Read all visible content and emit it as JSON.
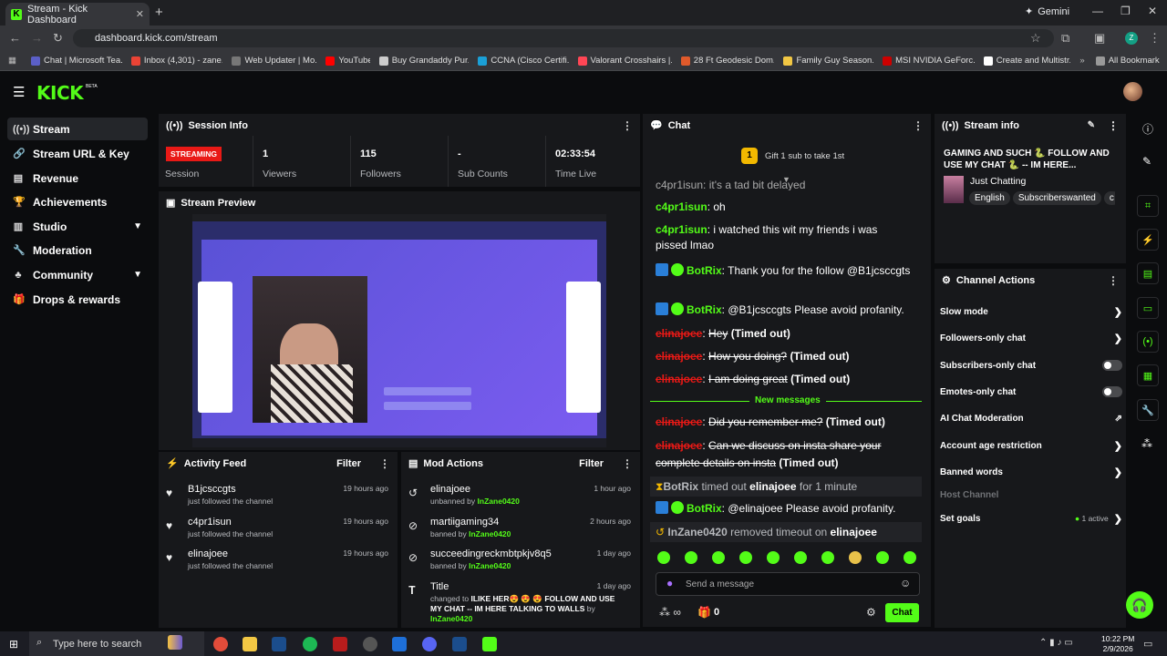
{
  "browser": {
    "tab_title": "Stream - Kick Dashboard",
    "url": "dashboard.kick.com/stream",
    "gemini": "Gemini",
    "bookmarks": [
      "Chat | Microsoft Tea...",
      "Inbox (4,301) - zane...",
      "Web Updater | Mo...",
      "YouTube",
      "Buy Grandaddy Pur...",
      "CCNA (Cisco Certifi...",
      "Valorant Crosshairs |...",
      "28 Ft Geodesic Dom...",
      "Family Guy Season...",
      "MSI NVIDIA GeForc...",
      "Create and Multistr..."
    ],
    "all_bookmarks": "All Bookmarks"
  },
  "brand": {
    "logo": "KICK",
    "beta": "BETA"
  },
  "sidebar": {
    "items": [
      {
        "label": "Stream",
        "icon": "broadcast-icon"
      },
      {
        "label": "Stream URL & Key",
        "icon": "link-icon"
      },
      {
        "label": "Revenue",
        "icon": "revenue-icon"
      },
      {
        "label": "Achievements",
        "icon": "trophy-icon"
      },
      {
        "label": "Studio",
        "icon": "studio-icon"
      },
      {
        "label": "Moderation",
        "icon": "wrench-icon"
      },
      {
        "label": "Community",
        "icon": "community-icon"
      },
      {
        "label": "Drops & rewards",
        "icon": "gift-icon"
      }
    ]
  },
  "session": {
    "title": "Session Info",
    "status": "STREAMING",
    "status_label": "Session",
    "stats": [
      {
        "value": "1",
        "label": "Viewers"
      },
      {
        "value": "115",
        "label": "Followers"
      },
      {
        "value": "-",
        "label": "Sub Counts"
      },
      {
        "value": "02:33:54",
        "label": "Time Live"
      }
    ]
  },
  "preview": {
    "title": "Stream Preview"
  },
  "activity": {
    "title": "Activity Feed",
    "filter": "Filter",
    "items": [
      {
        "name": "B1jcsccgts",
        "sub": "just followed the channel",
        "time": "19 hours ago"
      },
      {
        "name": "c4pr1isun",
        "sub": "just followed the channel",
        "time": "19 hours ago"
      },
      {
        "name": "elinajoee",
        "sub": "just followed the channel",
        "time": "19 hours ago"
      }
    ]
  },
  "mod": {
    "title": "Mod Actions",
    "filter": "Filter",
    "items": [
      {
        "name": "elinajoee",
        "action": "unbanned by",
        "by": "InZane0420",
        "time": "1 hour ago"
      },
      {
        "name": "martiigaming34",
        "action": "banned by",
        "by": "InZane0420",
        "time": "2 hours ago"
      },
      {
        "name": "succeedingreckmbtpkjv8q5",
        "action": "banned by",
        "by": "InZane0420",
        "time": "1 day ago"
      },
      {
        "name": "Title",
        "action": "changed to",
        "detail": "ILIKE HER😍 😍 😍 FOLLOW AND USE MY CHAT -- IM HERE TALKING TO WALLS",
        "by_prefix": "by",
        "by": "InZane0420",
        "time": "1 day ago"
      }
    ]
  },
  "chat": {
    "title": "Chat",
    "gift": "Gift 1 sub to take 1st",
    "gift_count": "1",
    "partial": "c4pr1isun: it's a tad bit delayed",
    "messages": [
      {
        "user": "c4pr1isun",
        "text": "oh"
      },
      {
        "user": "c4pr1isun",
        "text": "i watched this wit my friends i was pissed lmao"
      },
      {
        "user": "BotRix",
        "text": "Thank you for the follow @B1jcsccgts"
      },
      {
        "user": "BotRix",
        "text": "@B1jcsccgts Please avoid profanity."
      },
      {
        "user": "elinajoee",
        "text": "Hey",
        "note": "(Timed out)"
      },
      {
        "user": "elinajoee",
        "text": "How you doing?",
        "note": "(Timed out)"
      },
      {
        "user": "elinajoee",
        "text": "I am doing great",
        "note": "(Timed out)"
      },
      {
        "user": "elinajoee",
        "text": "Did you remember me?",
        "note": "(Timed out)"
      },
      {
        "user": "elinajoee",
        "text": "Can we discuss on insta share your complete details on insta",
        "note": "(Timed out)"
      },
      {
        "user": "BotRix",
        "text": "@elinajoee Please avoid profanity."
      }
    ],
    "new_messages": "New messages",
    "system1": {
      "actor": "BotRix",
      "mid": "timed out",
      "target": "elinajoee",
      "tail": "for 1 minute"
    },
    "system2": {
      "actor": "InZane0420",
      "mid": "removed timeout on",
      "target": "elinajoee"
    },
    "placeholder": "Send a message",
    "points": "0",
    "send": "Chat"
  },
  "stream_info": {
    "title": "Stream info",
    "stream_title": "GAMING AND SUCH 🐍 FOLLOW AND USE MY CHAT 🐍 -- IM HERE...",
    "category": "Just Chatting",
    "tags": [
      "English",
      "Subscriberswanted",
      "c"
    ]
  },
  "actions": {
    "title": "Channel Actions",
    "items": [
      {
        "label": "Slow mode",
        "control": "chevron"
      },
      {
        "label": "Followers-only chat",
        "control": "chevron"
      },
      {
        "label": "Subscribers-only chat",
        "control": "toggle"
      },
      {
        "label": "Emotes-only chat",
        "control": "toggle"
      },
      {
        "label": "AI Chat Moderation",
        "control": "external"
      },
      {
        "label": "Account age restriction",
        "control": "chevron"
      },
      {
        "label": "Banned words",
        "control": "chevron"
      },
      {
        "label": "Host Channel",
        "control": "none"
      },
      {
        "label": "Set goals",
        "control": "chevron",
        "status": "1 active"
      }
    ]
  },
  "taskbar": {
    "search": "Type here to search",
    "time": "10:22 PM",
    "date": "2/9/2026"
  }
}
